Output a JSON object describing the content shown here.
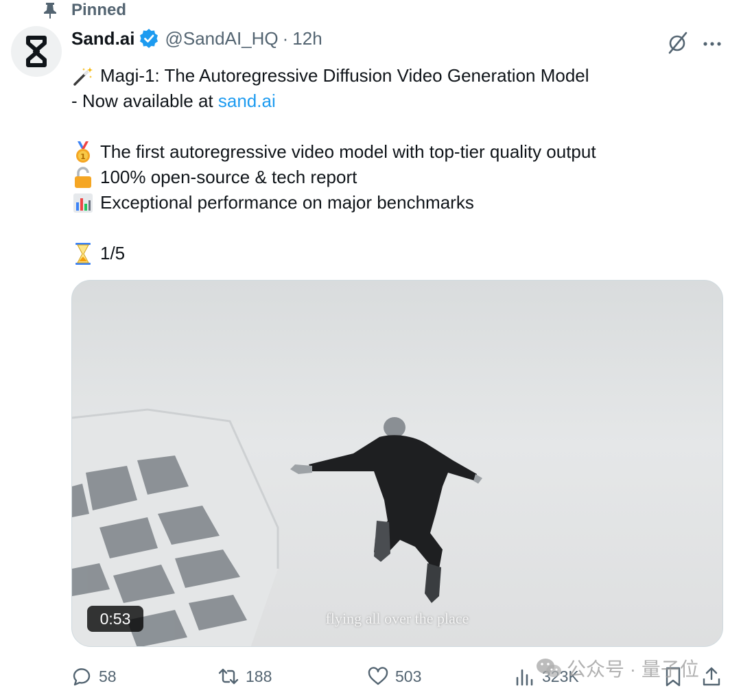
{
  "pinned_label": "Pinned",
  "author": {
    "name": "Sand.ai",
    "handle": "@SandAI_HQ",
    "separator": "·",
    "time": "12h"
  },
  "tweet": {
    "line1": "Magi-1: The Autoregressive Diffusion Video Generation Model",
    "line2_prefix": "- Now available at",
    "line2_link": "sand.ai",
    "bullets": [
      {
        "icon": "medal-icon",
        "text": "The first autoregressive video model with top-tier quality output"
      },
      {
        "icon": "unlocked-icon",
        "text": "100% open-source & tech report"
      },
      {
        "icon": "bar-chart-icon",
        "text": "Exceptional performance on major benchmarks"
      }
    ],
    "thread_counter": "1/5"
  },
  "media": {
    "duration": "0:53",
    "caption": "flying all over the place"
  },
  "actions": {
    "replies": "58",
    "reposts": "188",
    "likes": "503",
    "views": "323K"
  },
  "watermark": "公众号 · 量子位",
  "colors": {
    "link": "#1d9bf0",
    "verified": "#1d9bf0",
    "secondary_text": "#536471",
    "primary_text": "#0f1419"
  }
}
